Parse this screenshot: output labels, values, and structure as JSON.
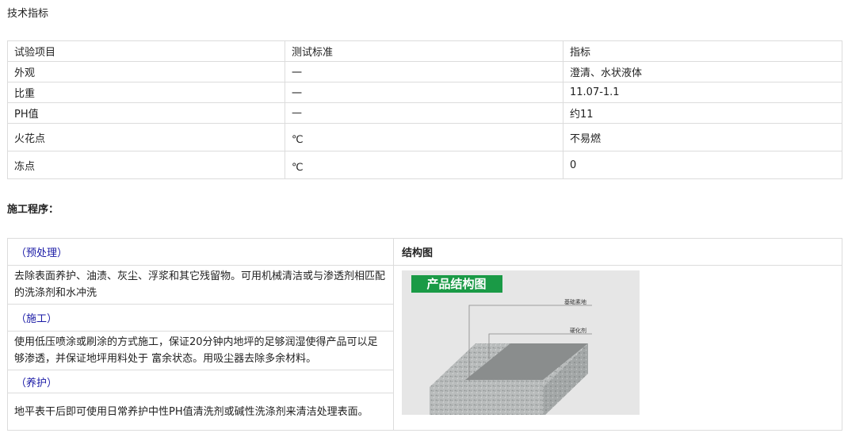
{
  "tech": {
    "title": "技术指标",
    "headers": [
      "试验项目",
      "测试标准",
      "指标"
    ],
    "rows": [
      {
        "item": "外观",
        "standard": "一",
        "value": "澄清、水状液体"
      },
      {
        "item": "比重",
        "standard": "一",
        "value": "11.07-1.1"
      },
      {
        "item": "PH值",
        "standard": "—",
        "value": "约11"
      },
      {
        "item": "火花点",
        "standard": "℃",
        "value": "不易燃"
      },
      {
        "item": "冻点",
        "standard": "℃",
        "value": "0"
      }
    ]
  },
  "procedure": {
    "title": "施工程序：",
    "steps": [
      {
        "heading": "（预处理）",
        "text": "去除表面养护、油渍、灰尘、浮浆和其它残留物。可用机械清洁或与渗透剂相匹配的洗涤剂和水冲洗"
      },
      {
        "heading": "（施工）",
        "text": " 使用低压喷涂或刷涂的方式施工，保证20分钟内地坪的足够润湿使得产品可以足够渗透，并保证地坪用料处于 富余状态。用吸尘器去除多余材料。"
      },
      {
        "heading": "（养护）",
        "text": " 地平表干后即可使用日常养护中性PH值清洗剂或碱性洗涤剂来清洁处理表面。"
      }
    ],
    "structure": {
      "title": "结构图",
      "banner": "产品结构图",
      "label_base": "基础素地",
      "label_hardener": "硬化剂"
    }
  },
  "colors": {
    "link": "#1a1aa6",
    "banner": "#1a9a46",
    "border": "#dcdcdc"
  }
}
